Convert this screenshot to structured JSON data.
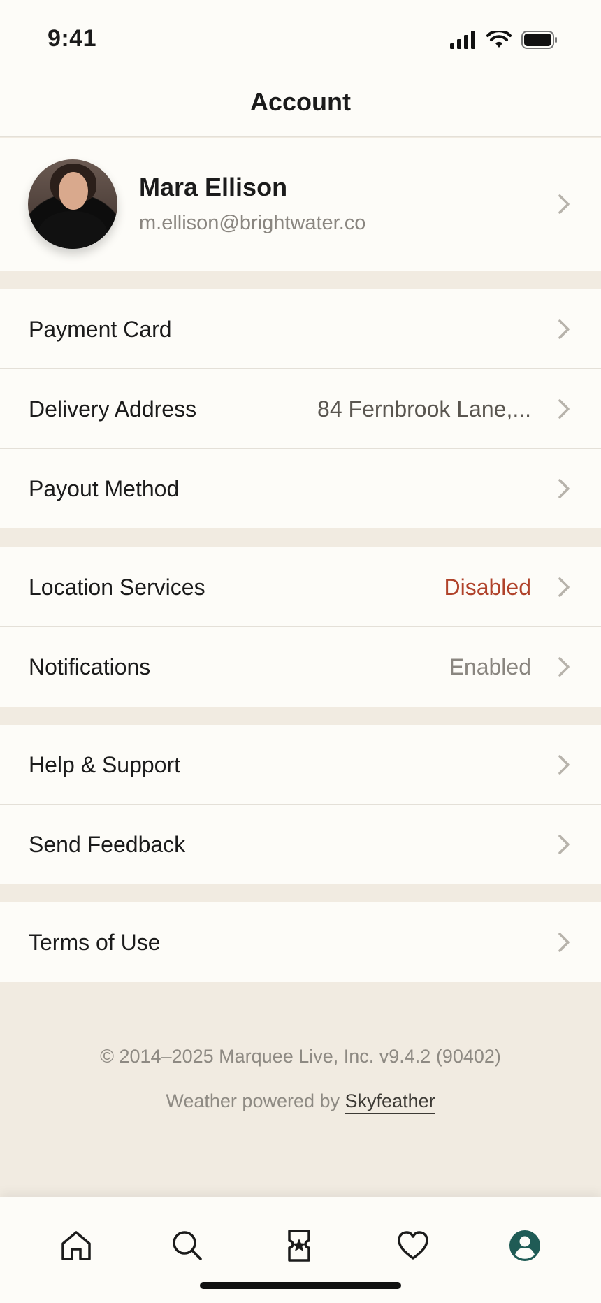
{
  "status_bar": {
    "time": "9:41"
  },
  "header": {
    "title": "Account"
  },
  "profile": {
    "name": "Mara Ellison",
    "email": "m.ellison@brightwater.co"
  },
  "sections": {
    "payments": {
      "payment_card": {
        "label": "Payment Card"
      },
      "delivery_address": {
        "label": "Delivery Address",
        "value": "84 Fernbrook Lane,..."
      },
      "payout_method": {
        "label": "Payout Method"
      }
    },
    "permissions": {
      "location_services": {
        "label": "Location Services",
        "value": "Disabled"
      },
      "notifications": {
        "label": "Notifications",
        "value": "Enabled"
      }
    },
    "support": {
      "help": {
        "label": "Help & Support"
      },
      "feedback": {
        "label": "Send Feedback"
      }
    },
    "legal": {
      "terms": {
        "label": "Terms of Use"
      }
    }
  },
  "footer": {
    "copyright": "© 2014–2025 Marquee Live, Inc. v9.4.2 (90402)",
    "weather_prefix": "Weather powered by",
    "weather_link": "Skyfeather"
  },
  "tab_bar": {
    "items": [
      "home-icon",
      "search-icon",
      "ticket-star-icon",
      "heart-icon",
      "profile-icon"
    ],
    "active": "profile-icon"
  },
  "colors": {
    "background": "#fdfcf8",
    "section_gap": "#f1ebe1",
    "alert": "#b0432b",
    "active_tab": "#1f5b55"
  }
}
